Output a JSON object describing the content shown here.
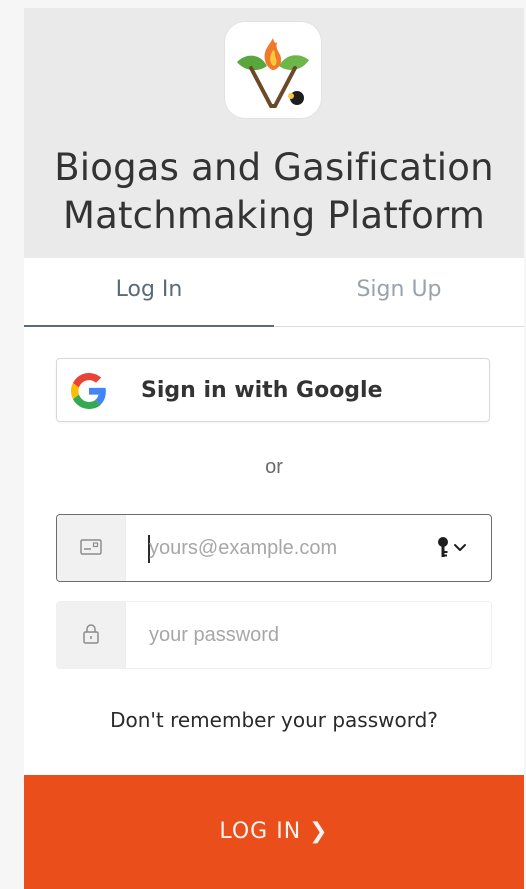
{
  "header": {
    "title_line1": "Biogas and Gasification",
    "title_line2": "Matchmaking Platform"
  },
  "tabs": [
    {
      "label": "Log In",
      "active": true
    },
    {
      "label": "Sign Up",
      "active": false
    }
  ],
  "google_button": {
    "label": "Sign in with Google",
    "icon": "google-icon"
  },
  "separator": {
    "label": "or"
  },
  "email_field": {
    "value": "",
    "placeholder": "yours@example.com",
    "icon": "mail-card-icon",
    "trailing_icon": "key-dropdown-icon"
  },
  "password_field": {
    "value": "",
    "placeholder": "your password",
    "icon": "lock-icon"
  },
  "forgot_link": {
    "label": "Don't remember your password?"
  },
  "submit_button": {
    "label": "LOG IN ❯"
  },
  "colors": {
    "accent": "#e94e1b",
    "header_bg": "#eaeaea",
    "tab_active": "#5b6b7a",
    "tab_inactive": "#9aa2aa"
  }
}
